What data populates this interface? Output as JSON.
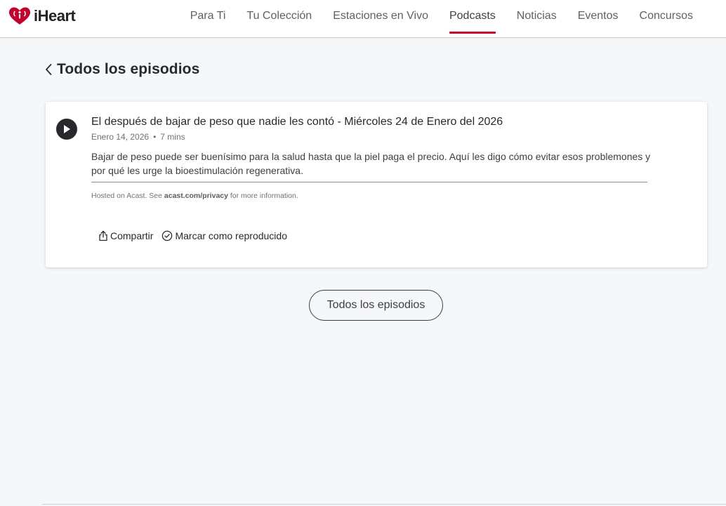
{
  "brand": {
    "name": "iHeart",
    "accent": "#c6002b"
  },
  "nav": {
    "items": [
      {
        "label": "Para Ti"
      },
      {
        "label": "Tu Colección"
      },
      {
        "label": "Estaciones en Vivo"
      },
      {
        "label": "Podcasts",
        "active": true
      },
      {
        "label": "Noticias"
      },
      {
        "label": "Eventos"
      },
      {
        "label": "Concursos"
      }
    ]
  },
  "page": {
    "back_title": "Todos los episodios"
  },
  "episode": {
    "title": "El después de bajar de peso que nadie les contó - Miércoles 24 de Enero del 2026",
    "date": "Enero 14, 2026",
    "separator": "•",
    "duration": "7 mins",
    "description": "Bajar de peso puede ser buenísimo para la salud hasta que la piel paga el precio. Aquí les digo cómo evitar esos problemones y por qué les urge la bioestimulación regenerativa.",
    "hosted_prefix": "Hosted on Acast. See ",
    "hosted_link": "acast.com/privacy",
    "hosted_suffix": " for more information.",
    "share_label": "Compartir",
    "mark_played_label": "Marcar como reproducido"
  },
  "all_episodes_button": "Todos los episodios"
}
